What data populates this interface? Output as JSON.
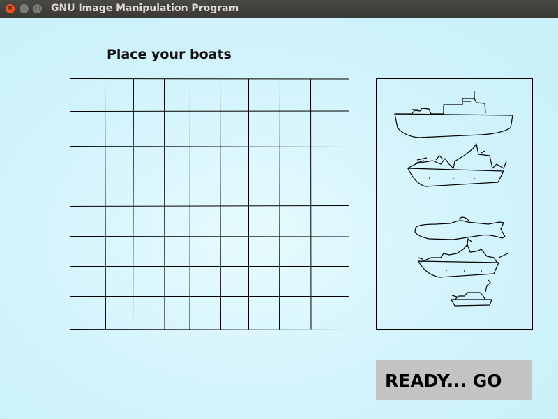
{
  "window": {
    "title": "GNU Image Manipulation Program",
    "controls": [
      "close",
      "minimize",
      "maximize"
    ]
  },
  "game": {
    "heading": "Place your boats",
    "board": {
      "rows": 8,
      "columns": 9
    },
    "fleet": [
      {
        "name": "aircraft-carrier-boat"
      },
      {
        "name": "battleship-boat"
      },
      {
        "name": "submarine-boat"
      },
      {
        "name": "destroyer-boat"
      },
      {
        "name": "patrol-boat"
      }
    ],
    "ready_button": "READY... GO"
  }
}
